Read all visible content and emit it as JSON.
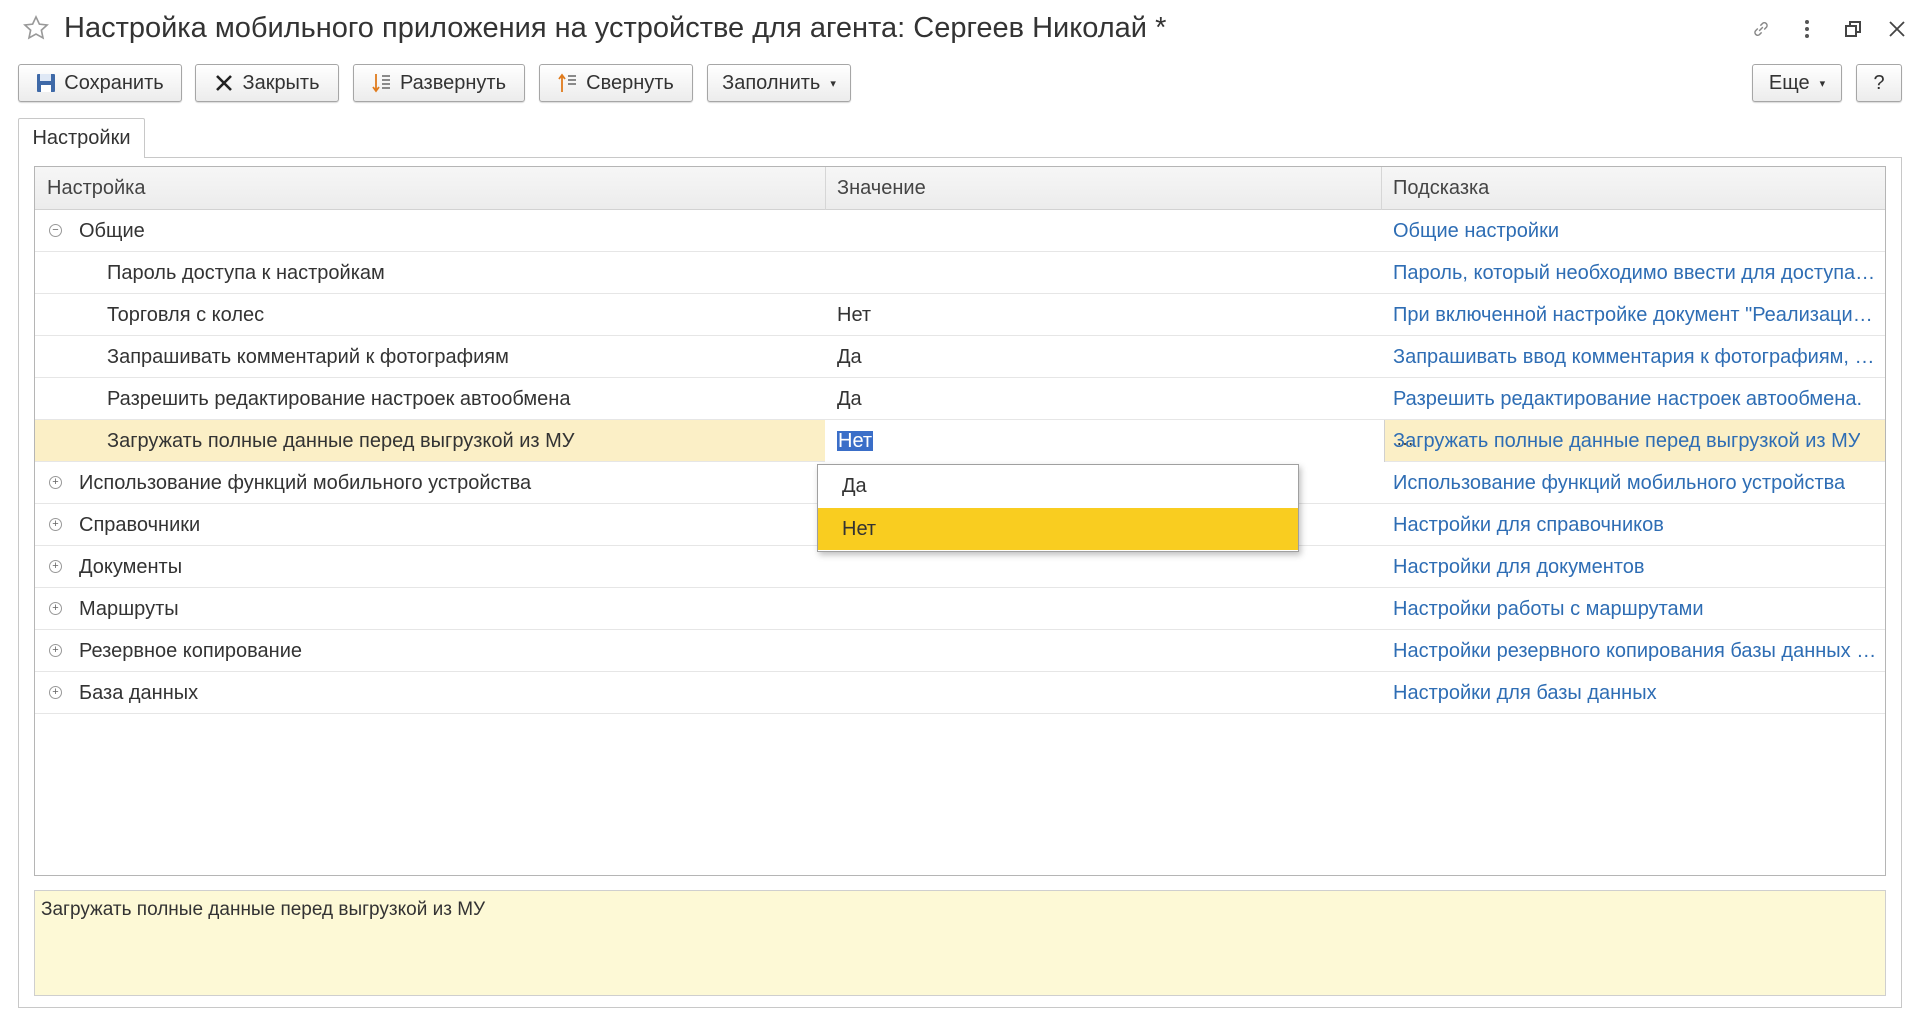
{
  "window": {
    "title": "Настройка мобильного приложения на устройстве для агента: Сергеев Николай *"
  },
  "toolbar": {
    "save_label": "Сохранить",
    "close_label": "Закрыть",
    "expand_label": "Развернуть",
    "collapse_label": "Свернуть",
    "fill_label": "Заполнить",
    "more_label": "Еще",
    "help_label": "?"
  },
  "tabs": [
    {
      "label": "Настройки"
    }
  ],
  "grid": {
    "columns": [
      "Настройка",
      "Значение",
      "Подсказка"
    ],
    "rows": [
      {
        "setting": "Общие",
        "value": "",
        "hint": "Общие настройки"
      },
      {
        "setting": "Пароль доступа к настройкам",
        "value": "",
        "hint": "Пароль, который необходимо ввести для доступа к настройкам"
      },
      {
        "setting": "Торговля с колес",
        "value": "Нет",
        "hint": "При включенной настройке документ \"Реализация товаров\""
      },
      {
        "setting": "Запрашивать комментарий к фотографиям",
        "value": "Да",
        "hint": "Запрашивать ввод комментария к фотографиям, сделанным"
      },
      {
        "setting": "Разрешить редактирование настроек автообмена",
        "value": "Да",
        "hint": "Разрешить редактирование настроек автообмена."
      },
      {
        "setting": "Загружать полные данные перед выгрузкой из МУ",
        "value": "Нет",
        "hint": "Загружать полные данные перед выгрузкой из МУ"
      },
      {
        "setting": "Использование функций мобильного устройства",
        "value": "",
        "hint": "Использование функций мобильного устройства"
      },
      {
        "setting": "Справочники",
        "value": "",
        "hint": "Настройки для справочников"
      },
      {
        "setting": "Документы",
        "value": "",
        "hint": "Настройки для документов"
      },
      {
        "setting": "Маршруты",
        "value": "",
        "hint": "Настройки работы с маршрутами"
      },
      {
        "setting": "Резервное копирование",
        "value": "",
        "hint": "Настройки резервного копирования базы данных мобильного"
      },
      {
        "setting": "База данных",
        "value": "",
        "hint": "Настройки для базы данных"
      }
    ]
  },
  "dropdown": {
    "options": [
      "Да",
      "Нет"
    ],
    "selected": "Нет"
  },
  "hint_panel": {
    "text": "Загружать полные данные перед выгрузкой из МУ"
  },
  "colors": {
    "accent_link": "#2e6db4",
    "selected_row": "#fbefc6",
    "dropdown_highlight": "#f9cd20",
    "hint_background": "#fdf9d6"
  }
}
